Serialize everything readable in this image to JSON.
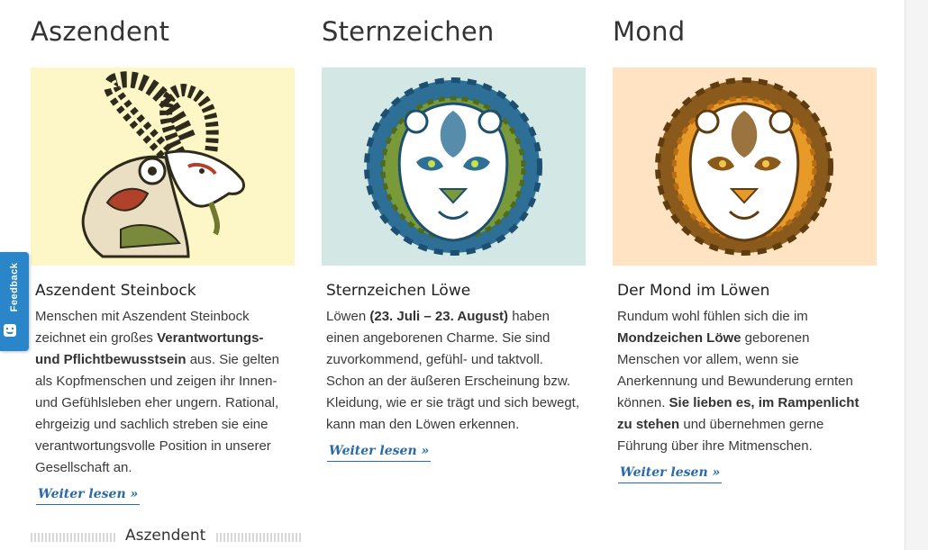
{
  "columns": [
    {
      "heading": "Aszendent",
      "image": {
        "name": "capricorn-ibex-illustration",
        "bg": "#fdf7c7"
      },
      "title": "Aszendent Steinbock",
      "text_html": "Menschen mit Aszendent Steinbock zeichnet ein großes <b>Verantwortungs- und Pflichtbewusstsein</b> aus. Sie gelten als Kopfmenschen und zeigen ihr Innen- und Gefühlsleben eher ungern. Rational, ehrgeizig und sachlich streben sie eine verantwortungsvolle Position in unserer Gesellschaft an.",
      "more": "Weiter lesen »"
    },
    {
      "heading": "Sternzeichen",
      "image": {
        "name": "lion-green-blue-illustration",
        "bg": "#d3e7e4"
      },
      "title": "Sternzeichen Löwe",
      "text_html": "Löwen <b>(23. Juli – 23. August)</b> haben einen angeborenen Charme. Sie sind zuvorkommend, gefühl- und taktvoll. Schon an der äußeren Erscheinung bzw. Kleidung, wie er sie trägt und sich bewegt, kann man den Löwen erkennen.",
      "more": "Weiter lesen »"
    },
    {
      "heading": "Mond",
      "image": {
        "name": "lion-orange-brown-illustration",
        "bg": "#ffe3c2"
      },
      "title": "Der Mond im Löwen",
      "text_html": "Rundum wohl fühlen sich die im <b>Mondzeichen Löwe</b> geborenen Menschen vor allem, wenn sie Anerkennung und Bewunderung ernten können. <b>Sie lieben es, im Rampenlicht zu stehen</b> und übernehmen gerne Führung über ihre Mitmenschen.",
      "more": "Weiter lesen »"
    }
  ],
  "section_footer": {
    "label": "Aszendent"
  },
  "feedback_tab": {
    "label": "Feedback",
    "color": "#2a86c8"
  },
  "colors": {
    "link": "#2b6aa8"
  }
}
